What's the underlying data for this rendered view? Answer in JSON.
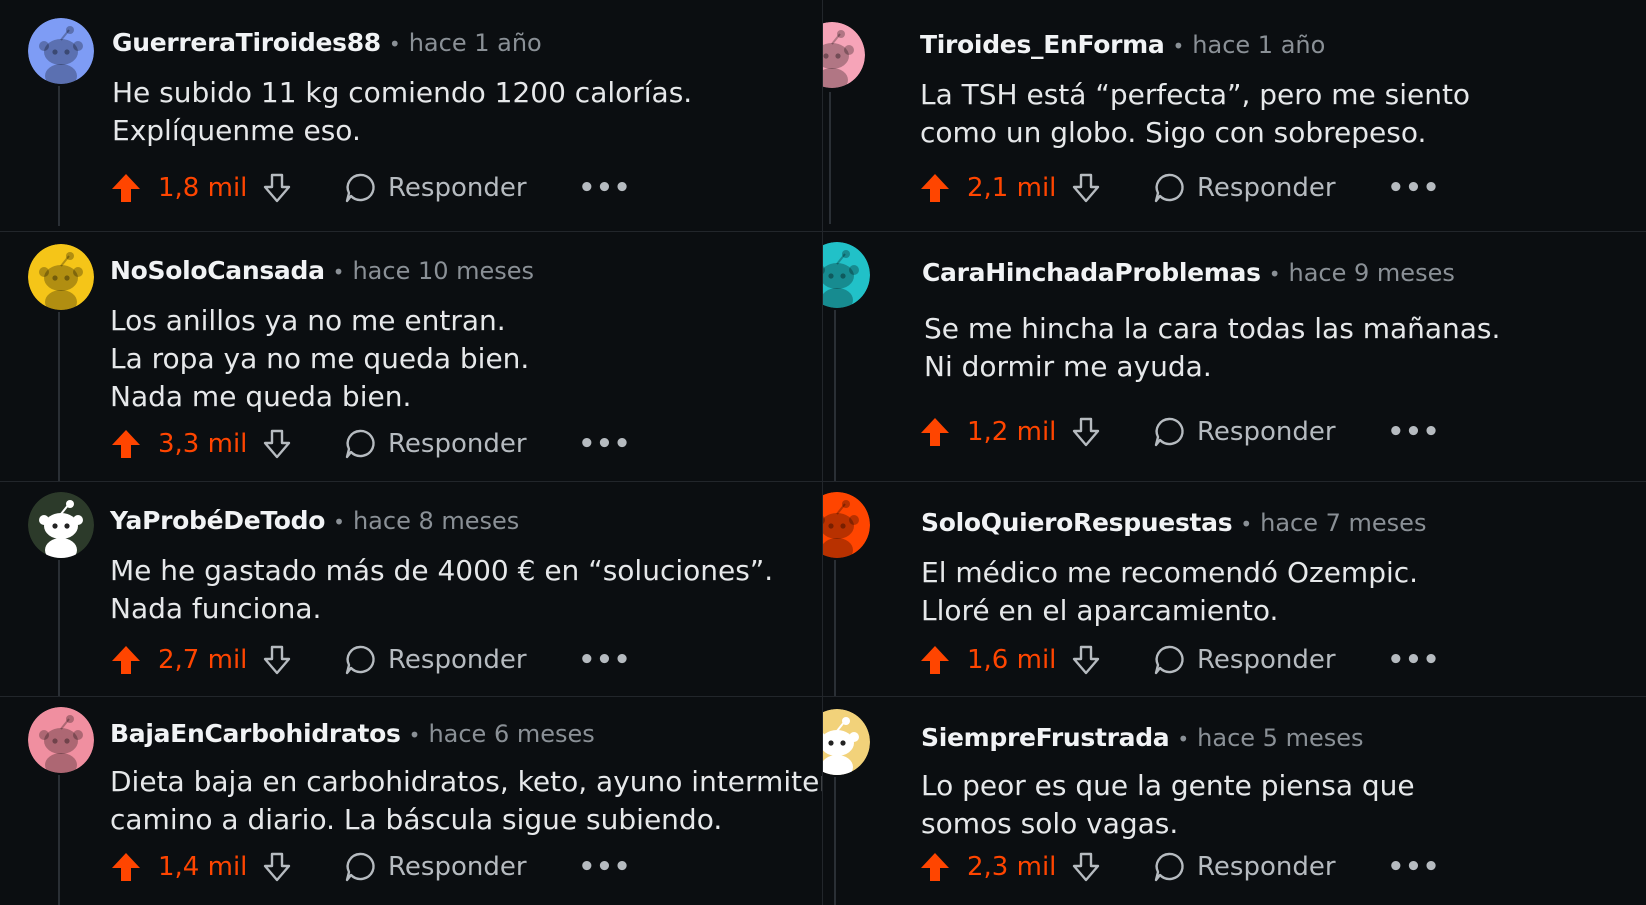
{
  "comments": [
    {
      "user": "GuerreraTiroides88",
      "time": "hace 1 año",
      "lines": [
        "He subido 11 kg comiendo 1200 calorías.",
        "Explíquenme eso."
      ],
      "score": "1,8 mil",
      "reply": "Responder",
      "avatar_color": "#7e9cf5"
    },
    {
      "user": "Tiroides_EnForma",
      "time": "hace 1 año",
      "lines": [
        "La TSH está “perfecta”, pero me siento",
        "como un globo. Sigo con sobrepeso."
      ],
      "score": "2,1 mil",
      "reply": "Responder",
      "avatar_color": "#f6a4b8"
    },
    {
      "user": "NoSoloCansada",
      "time": "hace 10 meses",
      "lines": [
        "Los anillos ya no me entran.",
        "La ropa ya no me queda bien.",
        "Nada me queda bien."
      ],
      "score": "3,3 mil",
      "reply": "Responder",
      "avatar_color": "#f5c518"
    },
    {
      "user": "CaraHinchadaProblemas",
      "time": "hace 9 meses",
      "lines": [
        "Se me hincha la cara todas las mañanas.",
        "Ni dormir me ayuda."
      ],
      "score": "1,2 mil",
      "reply": "Responder",
      "avatar_color": "#21c1c8"
    },
    {
      "user": "YaProbéDeTodo",
      "time": "hace 8 meses",
      "lines": [
        "Me he gastado más de 4000 € en “soluciones”.",
        "Nada funciona."
      ],
      "score": "2,7 mil",
      "reply": "Responder",
      "avatar_color": "#2c3a2a"
    },
    {
      "user": "SoloQuieroRespuestas",
      "time": "hace 7 meses",
      "lines": [
        "El médico me recomendó Ozempic.",
        "Lloré en el aparcamiento."
      ],
      "score": "1,6 mil",
      "reply": "Responder",
      "avatar_color": "#ff4500"
    },
    {
      "user": "BajaEnCarbohidratos",
      "time": "hace 6 meses",
      "lines": [
        "Dieta baja en carbohidratos, keto, ayuno intermitente,",
        "camino a diario. La báscula sigue subiendo."
      ],
      "score": "1,4 mil",
      "reply": "Responder",
      "avatar_color": "#f08fa0"
    },
    {
      "user": "SiempreFrustrada",
      "time": "hace 5 meses",
      "lines": [
        "Lo peor es que la gente piensa que",
        "somos solo vagas."
      ],
      "score": "2,3 mil",
      "reply": "Responder",
      "avatar_color": "#f2d27a"
    }
  ],
  "colors": {
    "accent": "#ff4500",
    "background": "#0b0e11",
    "text": "#e6e8ea",
    "muted": "#8a9096"
  },
  "icons": {
    "upvote": "upvote-arrow-icon",
    "downvote": "downvote-arrow-icon",
    "reply": "speech-bubble-icon",
    "more": "more-options-icon"
  },
  "more_glyph": "•••",
  "separator": "•"
}
